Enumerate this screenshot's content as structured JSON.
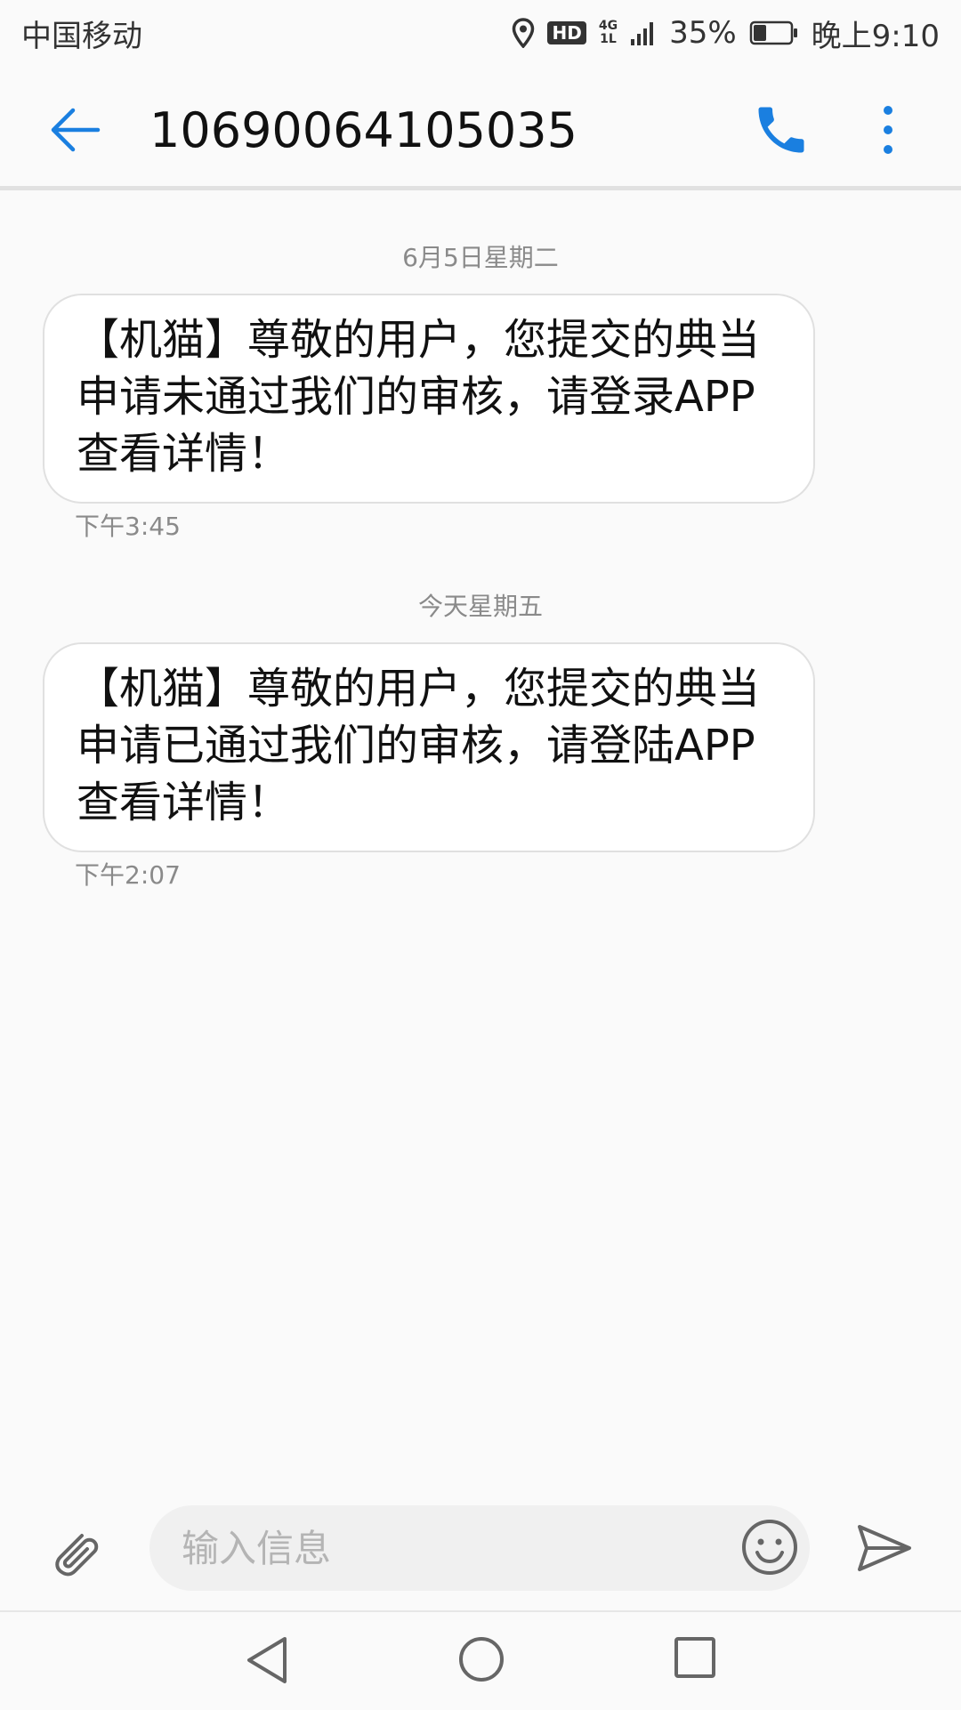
{
  "status_bar": {
    "carrier": "中国移动",
    "hd": "HD",
    "network": "4G",
    "network_sub": "1L",
    "battery_percent": "35%",
    "battery_level": 0.35,
    "time": "晚上9:10"
  },
  "header": {
    "title": "10690064105035"
  },
  "messages": [
    {
      "date": "6月5日星期二",
      "text": "【机猫】尊敬的用户，您提交的典当申请未通过我们的审核，请登录APP查看详情！",
      "time": "下午3:45"
    },
    {
      "date": "今天星期五",
      "text": "【机猫】尊敬的用户，您提交的典当申请已通过我们的审核，请登陆APP查看详情！",
      "time": "下午2:07"
    }
  ],
  "composer": {
    "placeholder": "输入信息",
    "value": ""
  },
  "colors": {
    "accent": "#1a7fe0",
    "background": "#fafafa",
    "bubble": "#ffffff",
    "secondary_text": "#8a8a8a"
  },
  "icons": {
    "back": "arrow-left-icon",
    "call": "phone-icon",
    "more": "more-vertical-icon",
    "attach": "paperclip-icon",
    "emoji": "smiley-icon",
    "send": "send-icon",
    "nav_back": "triangle-back-icon",
    "nav_home": "circle-home-icon",
    "nav_recent": "square-recent-icon"
  }
}
